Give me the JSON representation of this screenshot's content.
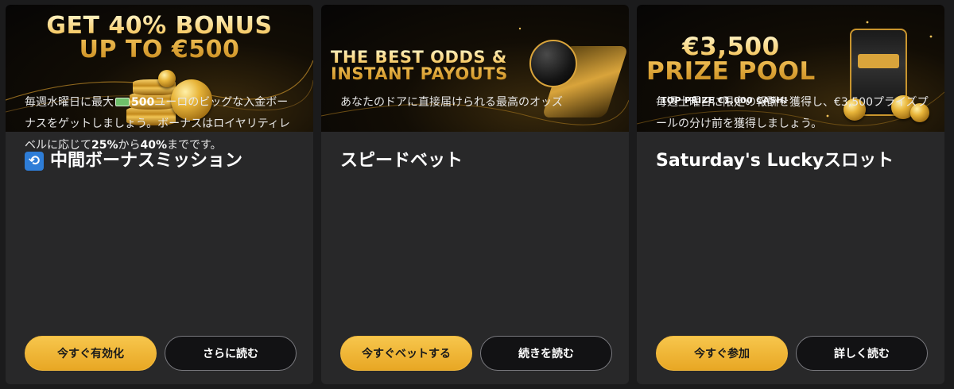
{
  "cards": [
    {
      "banner": {
        "line1": "GET 40% BONUS",
        "line2": "UP TO €500"
      },
      "title": "中間ボーナスミッション",
      "title_icon": "refresh-icon",
      "desc": {
        "before": "毎週水曜日に最大",
        "icon": "banknote-icon",
        "amount": "500",
        "after": "ユーロのビッグな入金ボーナスをゲットしましょう。ボーナスはロイヤリティレベルに応じて",
        "pct_from": "25%",
        "mid": "から",
        "pct_to": "40%",
        "end": "までです。"
      },
      "primary_label": "今すぐ有効化",
      "secondary_label": "さらに読む"
    },
    {
      "banner": {
        "line1": "THE BEST ODDS &",
        "line2": "INSTANT PAYOUTS"
      },
      "title": "スピードベット",
      "desc_text": "あなたのドアに直接届けられる最高のオッズ",
      "primary_label": "今すぐベットする",
      "secondary_label": "続きを読む"
    },
    {
      "banner": {
        "line1": "€3,500",
        "line2": "PRIZE POOL",
        "sub": "TOP PRIZE €1,000 CASH!"
      },
      "title": "Saturday's Luckyスロット",
      "desc_text": "毎週土曜日に限定の報酬を獲得し、€3,500プライズプールの分け前を獲得しましょう。",
      "primary_label": "今すぐ参加",
      "secondary_label": "詳しく読む"
    }
  ]
}
